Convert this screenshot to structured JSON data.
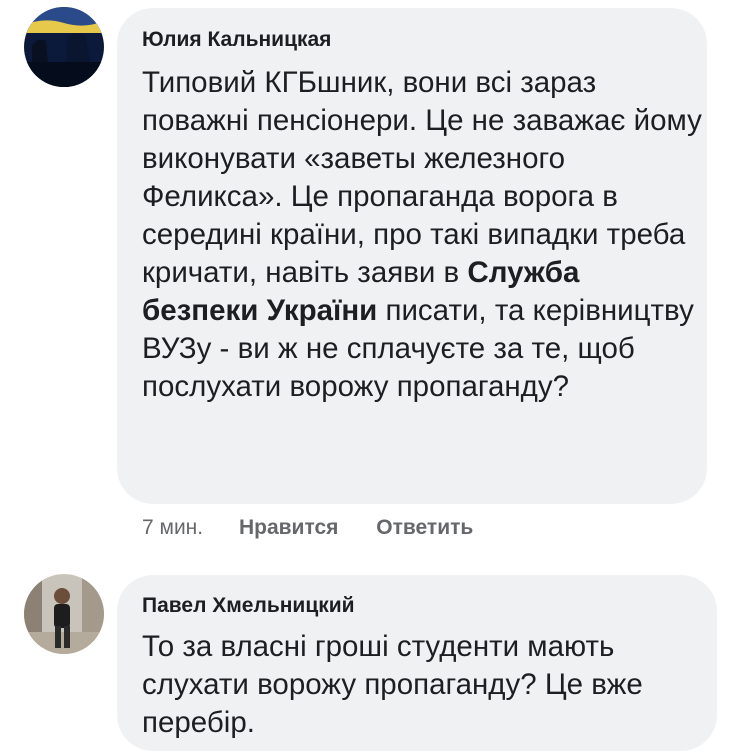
{
  "comments": [
    {
      "author": "Юлия Кальницкая",
      "text_before_bold": "Типовий КГБшник, вони всі зараз поважні пенсіонери. Це не заважає йому виконувати «заветы железного Феликса». Це пропаганда ворога в середині країни, про такі випадки треба кричати, навіть заяви в ",
      "text_bold": "Служба безпеки України",
      "text_after_bold": " писати, та керівництву ВУЗу - ви ж не сплачуєте за те, щоб послухати ворожу пропаганду?",
      "time": "7 мин.",
      "like_label": "Нравится",
      "reply_label": "Ответить",
      "avatar_icon": "avatar-photo-dark-blue-silhouette"
    },
    {
      "author": "Павел Хмельницкий",
      "text": "То за власні гроші студенти мають слухати ворожу пропаганду? Це вже перебір.",
      "avatar_icon": "avatar-photo-man-standing-street"
    }
  ],
  "colors": {
    "bubble_bg": "#f0f1f3",
    "text": "#1c1e21",
    "meta": "#65676b"
  }
}
